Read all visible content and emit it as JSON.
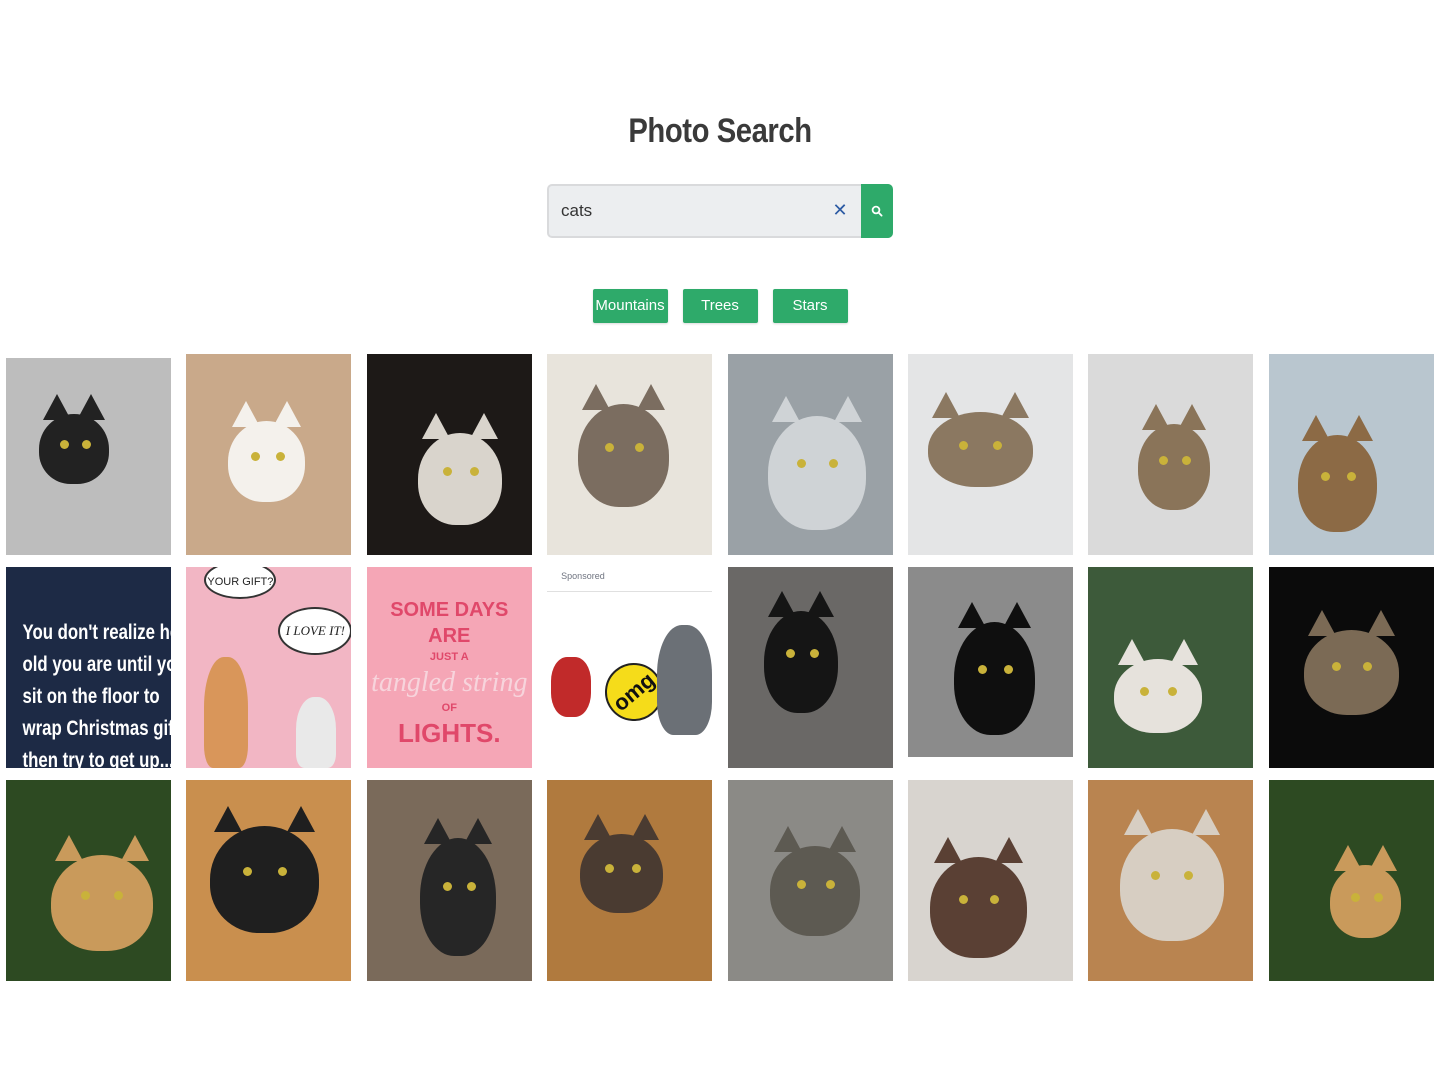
{
  "page": {
    "title": "Photo Search"
  },
  "search": {
    "value": "cats",
    "clear_icon": "close-icon",
    "submit_icon": "search-icon"
  },
  "tags": [
    {
      "label": "Mountains"
    },
    {
      "label": "Trees"
    },
    {
      "label": "Stars"
    }
  ],
  "colors": {
    "accent": "#2eaa6a",
    "title": "#3a3a3a",
    "input_bg": "#eceef0",
    "clear_icon": "#2b5aa3"
  },
  "photos": [
    {
      "subject": "black cat on striped rug",
      "bg": "#bdbdbd",
      "fg": "#222222"
    },
    {
      "subject": "calico cat on white chair",
      "bg": "#c9a98a",
      "fg": "#f4f1ec"
    },
    {
      "subject": "white and dark cat in shadow",
      "bg": "#1d1917",
      "fg": "#d9d4cc"
    },
    {
      "subject": "cat in a sink",
      "bg": "#e8e4dc",
      "fg": "#7b6d60"
    },
    {
      "subject": "grey long-haired cat",
      "bg": "#9aa1a6",
      "fg": "#cfd3d6"
    },
    {
      "subject": "tabby cat peeking",
      "bg": "#e4e5e6",
      "fg": "#8b7861"
    },
    {
      "subject": "tabby cat ears",
      "bg": "#dadada",
      "fg": "#8a7459"
    },
    {
      "subject": "cat by the sea with city skyline",
      "bg": "#b9c6cf",
      "fg": "#8c6a45"
    },
    {
      "subject": "text meme",
      "bg": "#1d2a45",
      "fg": "#ffffff",
      "caption": [
        "You don't realize how",
        "old you are until you",
        "sit on the floor to",
        "wrap Christmas gifts",
        "then try to get up..."
      ]
    },
    {
      "subject": "cartoon cats comic",
      "bg": "#f2b6c4",
      "fg": "#d9965a",
      "bubble_top": "YOUR GIFT?",
      "bubble_mid": "I LOVE IT!"
    },
    {
      "subject": "lettering card",
      "bg": "#f5a6b6",
      "fg": "#e0486a",
      "lines": [
        "SOME DAYS ARE",
        "JUST A",
        "tangled string",
        "OF",
        "LIGHTS."
      ]
    },
    {
      "subject": "sponsored omg cat ad",
      "bg": "#ffffff",
      "fg": "#6f7480",
      "sponsored": "Sponsored",
      "badge": "omg"
    },
    {
      "subject": "black cat with whiskers",
      "bg": "#6a6866",
      "fg": "#151515"
    },
    {
      "subject": "black cat on pavement",
      "bg": "#8b8b8b",
      "fg": "#0f0f0f"
    },
    {
      "subject": "calico cat in garden",
      "bg": "#3d5a3a",
      "fg": "#e6e2dc"
    },
    {
      "subject": "long-haired tabby on black",
      "bg": "#0b0b0b",
      "fg": "#7b6a55"
    },
    {
      "subject": "leopard yawning",
      "bg": "#2d4a22",
      "fg": "#c99a5b"
    },
    {
      "subject": "calico and black cat",
      "bg": "#c98f4e",
      "fg": "#1f1f1f"
    },
    {
      "subject": "calico and black cat close",
      "bg": "#7a6a5a",
      "fg": "#262626"
    },
    {
      "subject": "calico cuddling cat",
      "bg": "#b07a3e",
      "fg": "#4a3b31"
    },
    {
      "subject": "grey tabby cat",
      "bg": "#8b8a86",
      "fg": "#5d5a52"
    },
    {
      "subject": "siamese cat",
      "bg": "#d8d4cf",
      "fg": "#5a4034"
    },
    {
      "subject": "cat tree scratching post",
      "bg": "#b98450",
      "fg": "#d7cec2"
    },
    {
      "subject": "leopard yawning",
      "bg": "#2d4a22",
      "fg": "#c99a5b"
    }
  ]
}
